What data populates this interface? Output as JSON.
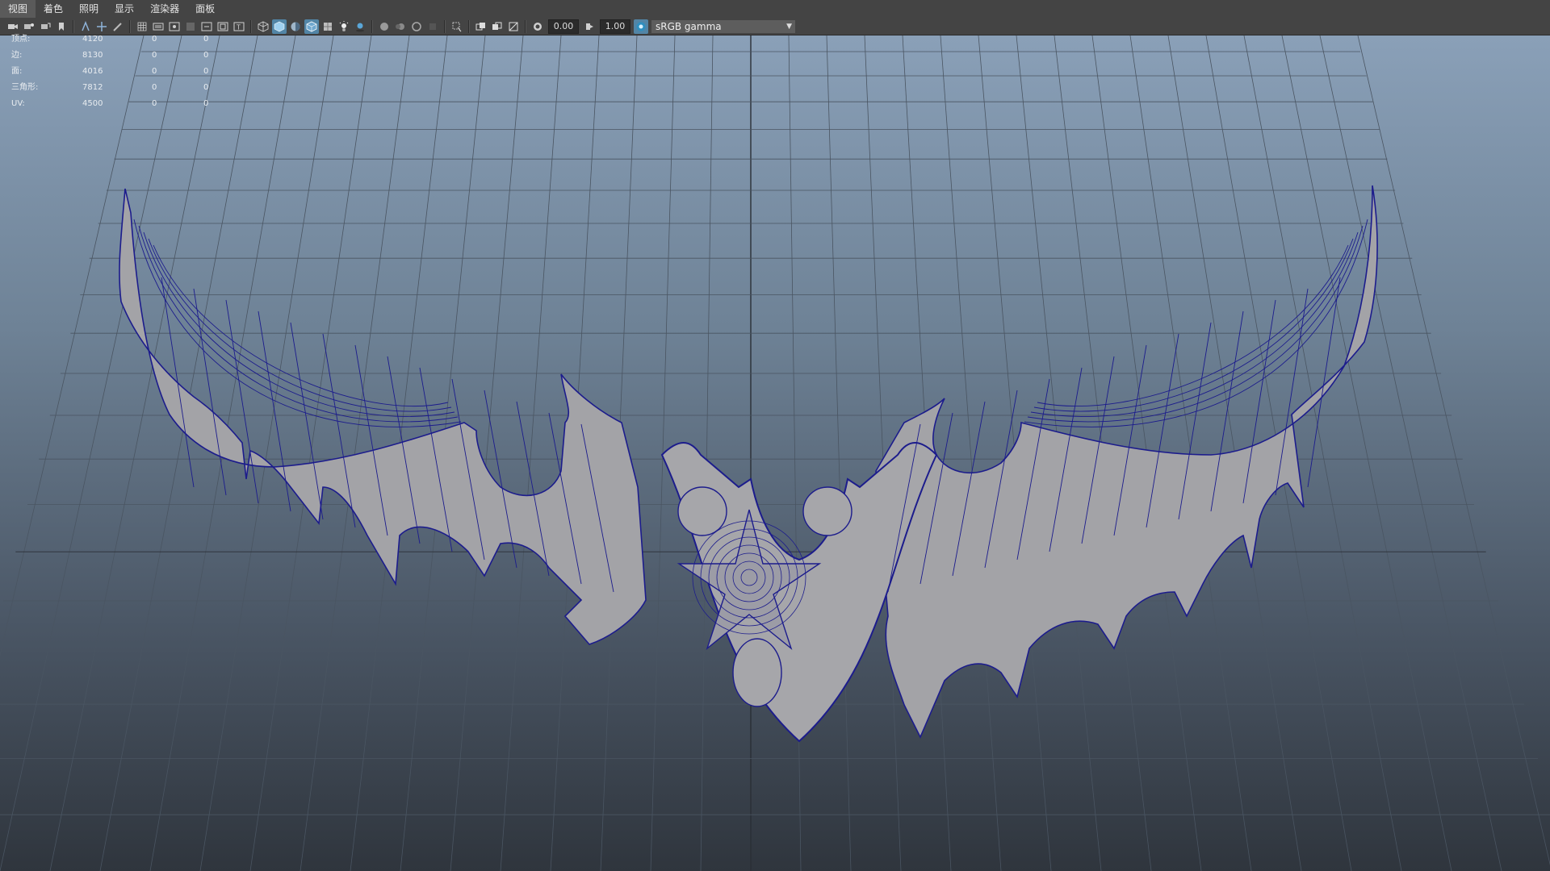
{
  "menu": [
    "视图",
    "着色",
    "照明",
    "显示",
    "渲染器",
    "面板"
  ],
  "toolbar": {
    "field1": "0.00",
    "field2": "1.00",
    "color_space": "sRGB gamma",
    "accent": "#5285a6"
  },
  "hud": {
    "rows": [
      {
        "label": "顶点:",
        "v1": "4120",
        "v2": "0",
        "v3": "0"
      },
      {
        "label": "边:",
        "v1": "8130",
        "v2": "0",
        "v3": "0"
      },
      {
        "label": "面:",
        "v1": "4016",
        "v2": "0",
        "v3": "0"
      },
      {
        "label": "三角形:",
        "v1": "7812",
        "v2": "0",
        "v3": "0"
      },
      {
        "label": "UV:",
        "v1": "4500",
        "v2": "0",
        "v3": "0"
      }
    ]
  },
  "viewport": {
    "camera": "persp",
    "mesh_fill": "#a3a3a7",
    "wire_color": "#1c1c8c"
  }
}
